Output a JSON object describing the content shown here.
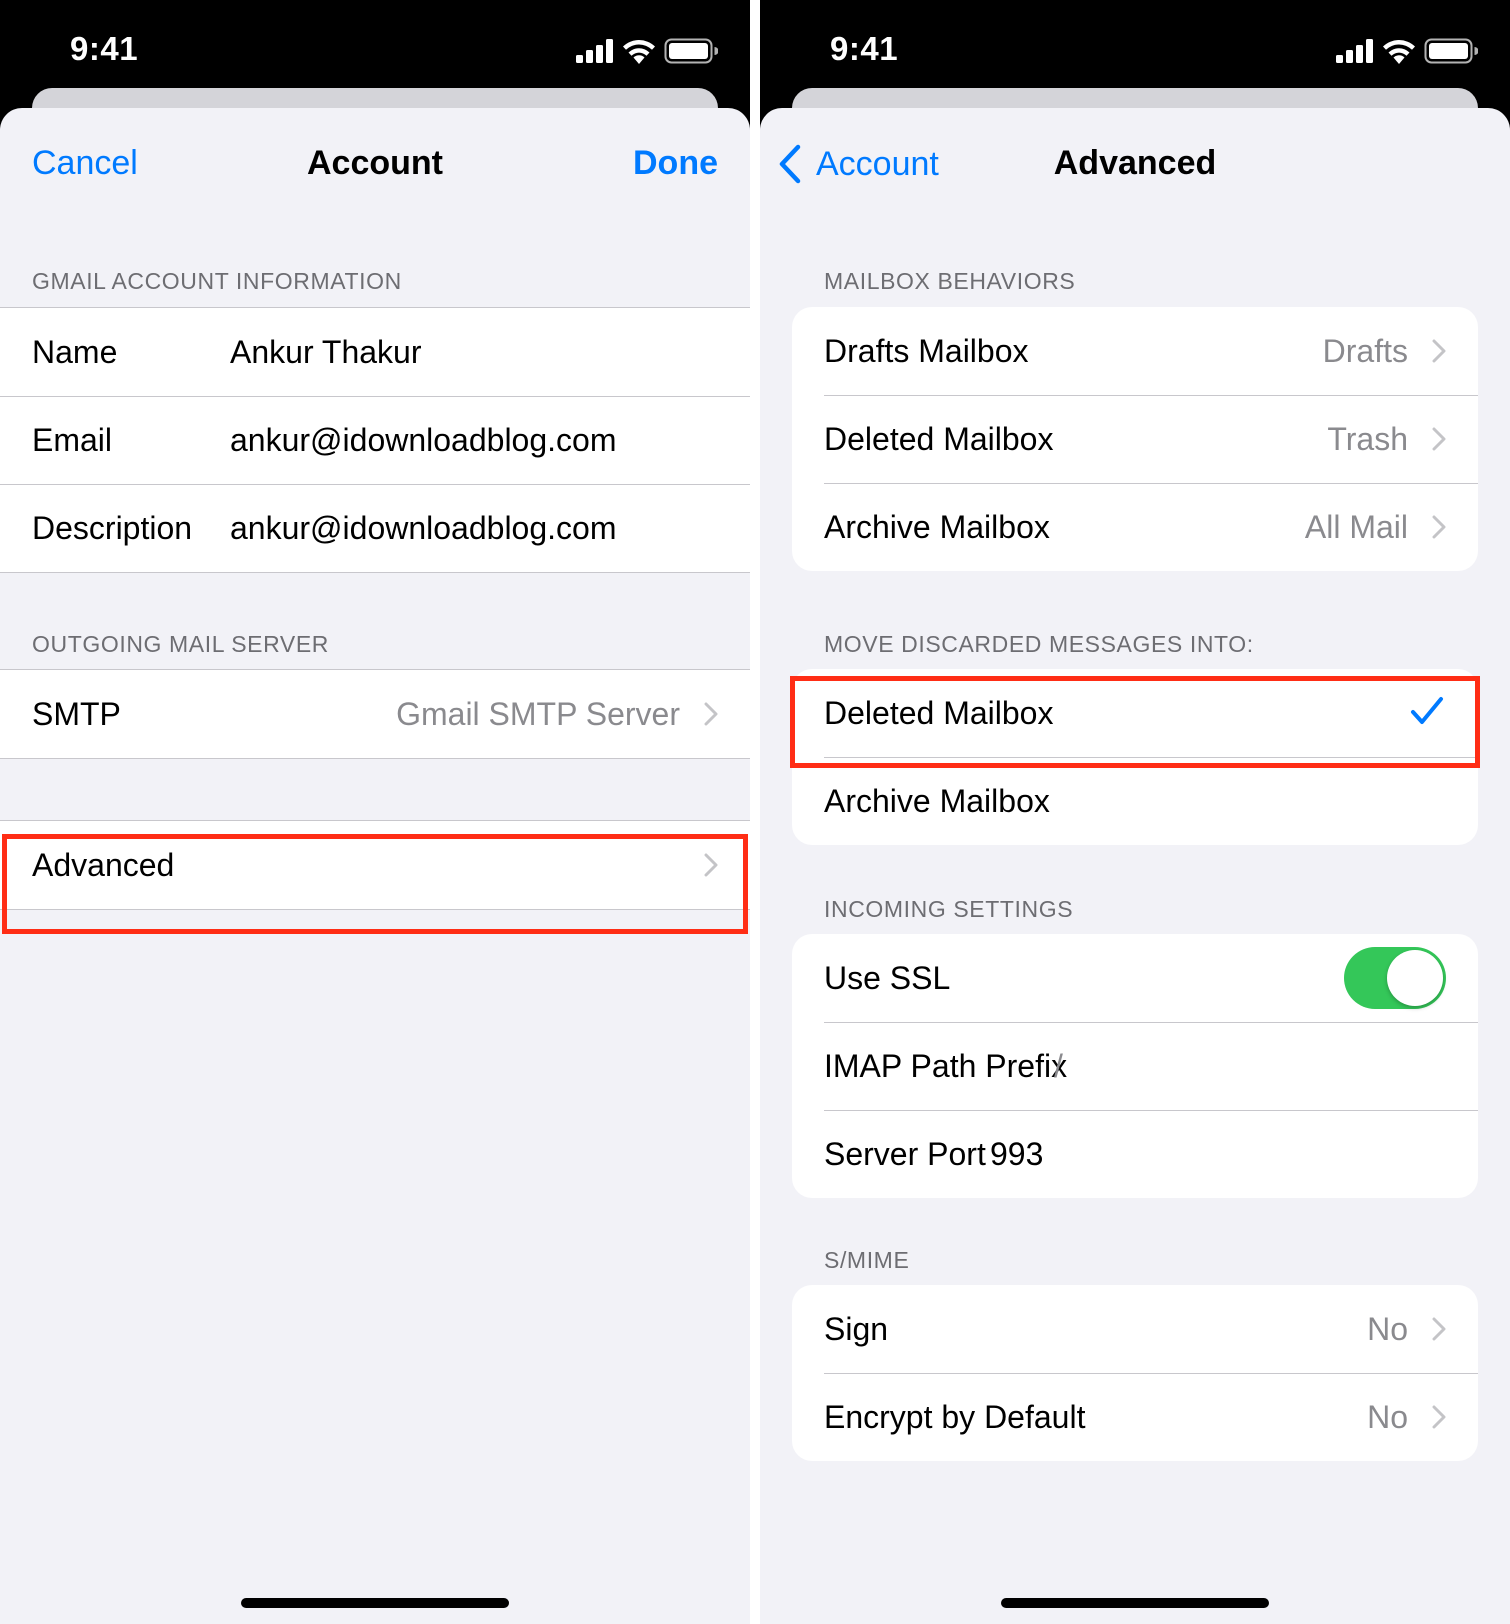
{
  "status": {
    "time": "9:41"
  },
  "left": {
    "nav": {
      "cancel": "Cancel",
      "title": "Account",
      "done": "Done"
    },
    "section_account": "GMAIL ACCOUNT INFORMATION",
    "account_rows": [
      {
        "label": "Name",
        "value": "Ankur Thakur"
      },
      {
        "label": "Email",
        "value": "ankur@idownloadblog.com"
      },
      {
        "label": "Description",
        "value": "ankur@idownloadblog.com"
      }
    ],
    "section_outgoing": "OUTGOING MAIL SERVER",
    "smtp": {
      "label": "SMTP",
      "value": "Gmail SMTP Server"
    },
    "advanced": {
      "label": "Advanced"
    }
  },
  "right": {
    "nav": {
      "back": "Account",
      "title": "Advanced"
    },
    "section_mailbox": "MAILBOX BEHAVIORS",
    "mailbox_rows": [
      {
        "label": "Drafts Mailbox",
        "value": "Drafts"
      },
      {
        "label": "Deleted Mailbox",
        "value": "Trash"
      },
      {
        "label": "Archive Mailbox",
        "value": "All Mail"
      }
    ],
    "section_discard": "MOVE DISCARDED MESSAGES INTO:",
    "discard_rows": [
      {
        "label": "Deleted Mailbox",
        "selected": true
      },
      {
        "label": "Archive Mailbox",
        "selected": false
      }
    ],
    "section_incoming": "INCOMING SETTINGS",
    "use_ssl": {
      "label": "Use SSL",
      "on": true
    },
    "imap_prefix": {
      "label": "IMAP Path Prefix",
      "value": "/"
    },
    "server_port": {
      "label": "Server Port",
      "value": "993"
    },
    "section_smime": "S/MIME",
    "sign": {
      "label": "Sign",
      "value": "No"
    },
    "encrypt": {
      "label": "Encrypt by Default",
      "value": "No"
    }
  },
  "colors": {
    "accent": "#007aff",
    "highlight": "#ff2d15",
    "toggle_on": "#34c759",
    "background": "#f2f2f7"
  },
  "icons": [
    "cellular-signal-icon",
    "wifi-icon",
    "battery-icon",
    "chevron-right-icon",
    "chevron-left-icon",
    "checkmark-icon"
  ]
}
